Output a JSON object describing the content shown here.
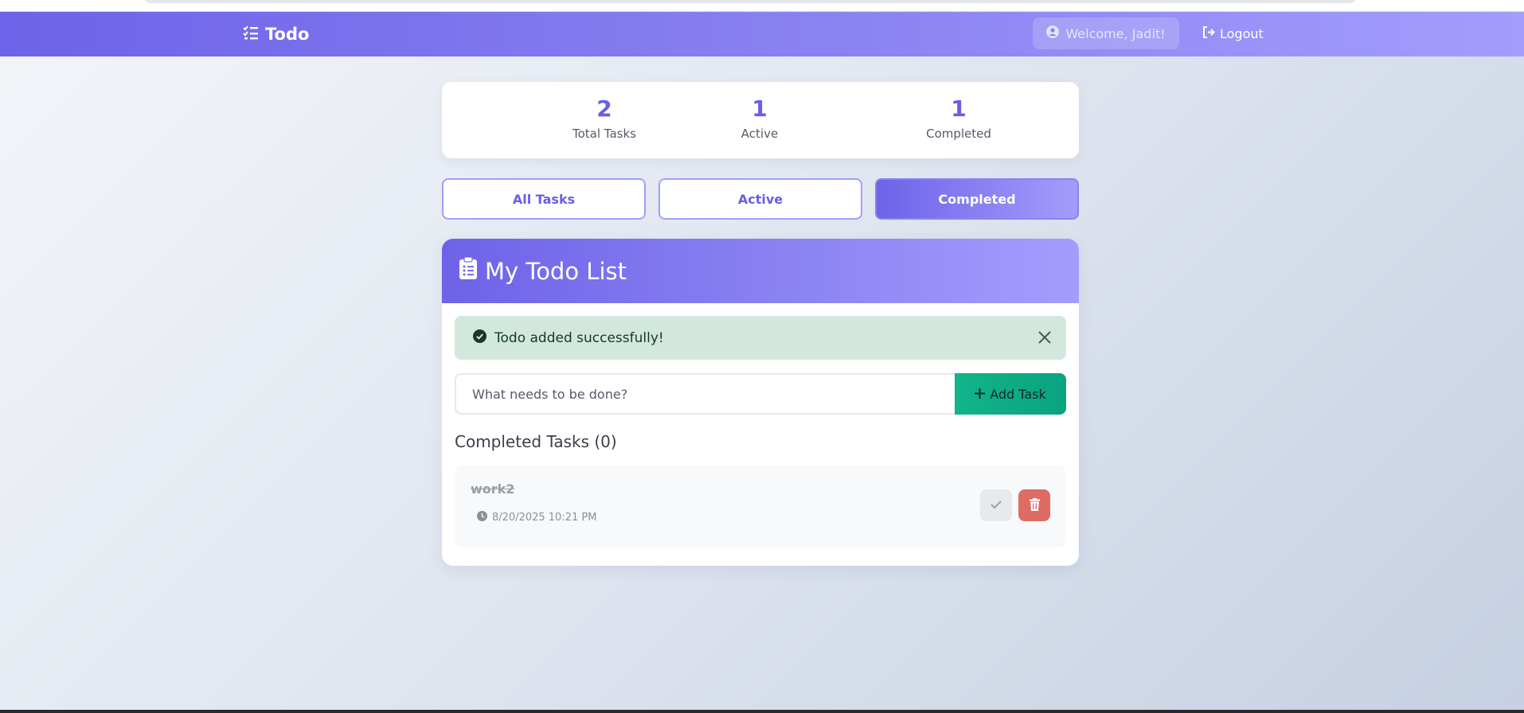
{
  "navbar": {
    "brand": "Todo",
    "brand_icon": "list-check-icon",
    "welcome": "Welcome, Jadit!",
    "welcome_icon": "user-circle-icon",
    "logout": "Logout",
    "logout_icon": "sign-out-icon"
  },
  "stats": [
    {
      "value": "2",
      "label": "Total Tasks"
    },
    {
      "value": "1",
      "label": "Active"
    },
    {
      "value": "1",
      "label": "Completed"
    }
  ],
  "filters": [
    {
      "label": "All Tasks",
      "active": false
    },
    {
      "label": "Active",
      "active": false
    },
    {
      "label": "Completed",
      "active": true
    }
  ],
  "card": {
    "title": "My Todo List",
    "title_icon": "clipboard-list-icon",
    "alert": {
      "message": "Todo added successfully!",
      "icon": "check-circle-icon"
    },
    "input": {
      "placeholder": "What needs to be done?",
      "value": ""
    },
    "add_button": "Add Task",
    "section_title": "Completed Tasks (0)",
    "todos": [
      {
        "text": "work2",
        "timestamp": "8/20/2025 10:21 PM",
        "completed": true
      }
    ]
  },
  "colors": {
    "primary": "#6e62e8",
    "primary_light": "#a49dfc",
    "success": "#0aa37f",
    "danger": "#de6b64",
    "alert_bg": "#d2e8dc"
  }
}
